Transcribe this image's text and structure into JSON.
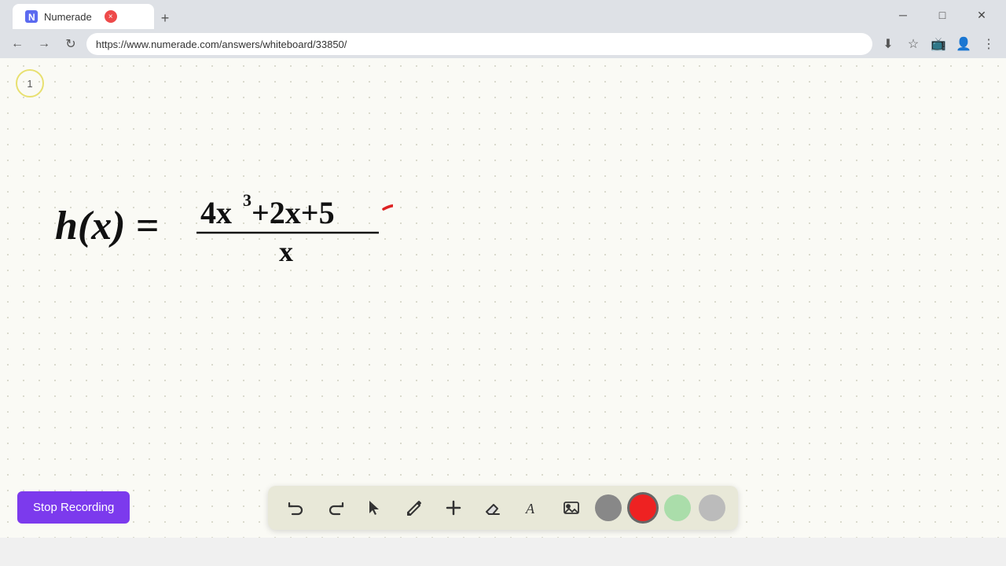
{
  "browser": {
    "tab_title": "Numerade",
    "tab_close_label": "×",
    "new_tab_label": "+",
    "url": "https://www.numerade.com/answers/whiteboard/33850/",
    "window_controls": {
      "minimize": "─",
      "maximize": "□",
      "close": "✕"
    },
    "nav_back": "←",
    "nav_forward": "→",
    "nav_refresh": "↻"
  },
  "page": {
    "page_number": "1",
    "formula": "h(x) = (4x³+2x+5) / x"
  },
  "toolbar": {
    "stop_recording_label": "Stop Recording",
    "tools": [
      {
        "name": "undo",
        "icon": "↺",
        "label": "Undo"
      },
      {
        "name": "redo",
        "icon": "↻",
        "label": "Redo"
      },
      {
        "name": "select",
        "icon": "▲",
        "label": "Select"
      },
      {
        "name": "pencil",
        "icon": "✏",
        "label": "Pencil"
      },
      {
        "name": "add",
        "icon": "+",
        "label": "Add"
      },
      {
        "name": "eraser",
        "icon": "⌫",
        "label": "Eraser"
      },
      {
        "name": "text",
        "icon": "A",
        "label": "Text"
      },
      {
        "name": "image",
        "icon": "🖼",
        "label": "Image"
      }
    ],
    "colors": [
      {
        "name": "gray",
        "value": "#888888"
      },
      {
        "name": "red",
        "value": "#ee2222"
      },
      {
        "name": "green",
        "value": "#aaddaa"
      },
      {
        "name": "light-gray",
        "value": "#bbbbbb"
      }
    ]
  }
}
